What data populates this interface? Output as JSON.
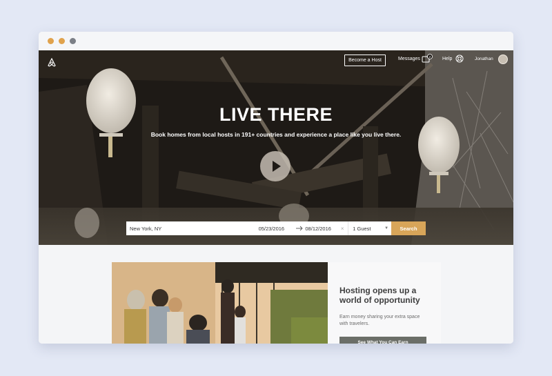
{
  "navbar": {
    "become_host": "Become a Host",
    "messages": "Messages",
    "messages_badge": "2",
    "help": "Help",
    "user_name": "Jonathan"
  },
  "hero": {
    "title": "LIVE THERE",
    "subtitle": "Book homes from local hosts in 191+ countries and experience a place like you live there."
  },
  "search": {
    "location": "New York, NY",
    "checkin": "05/23/2016",
    "checkout": "08/12/2016",
    "clear": "×",
    "guests": "1 Guest",
    "button": "Search"
  },
  "promo": {
    "title": "Hosting opens up a world of opportunity",
    "text": "Earn money sharing your extra space with travelers.",
    "button": "See What You Can Earn"
  },
  "colors": {
    "accent": "#d8a559",
    "page_bg": "#e3e8f5",
    "hero_bg": "#1c1814",
    "button_gray": "#6b6e68"
  },
  "icons": [
    "airbnb-logo-icon",
    "messages-icon",
    "help-icon",
    "play-icon",
    "arrow-right-icon",
    "chevron-down-icon"
  ]
}
